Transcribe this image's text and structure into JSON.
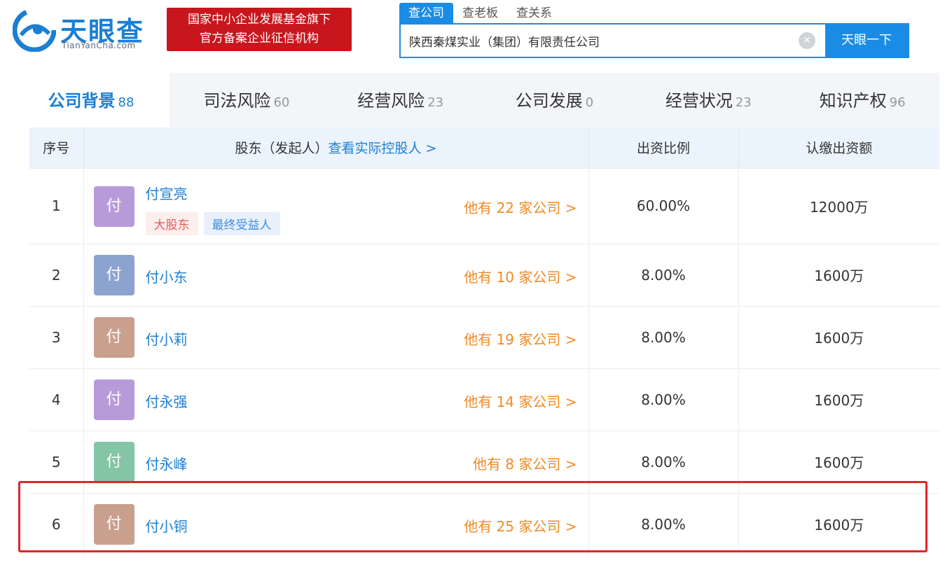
{
  "brand": {
    "name": "天眼查",
    "domain": "TianYanCha.com",
    "slogan_line1": "国家中小企业发展基金旗下",
    "slogan_line2": "官方备案企业征信机构"
  },
  "search": {
    "tabs": [
      "查公司",
      "查老板",
      "查关系"
    ],
    "active_tab": 0,
    "value": "陕西秦煤实业（集团）有限责任公司",
    "button_label": "天眼一下"
  },
  "category_tabs": [
    {
      "label": "公司背景",
      "count": "88"
    },
    {
      "label": "司法风险",
      "count": "60"
    },
    {
      "label": "经营风险",
      "count": "23"
    },
    {
      "label": "公司发展",
      "count": "0"
    },
    {
      "label": "经营状况",
      "count": "23"
    },
    {
      "label": "知识产权",
      "count": "96"
    }
  ],
  "table": {
    "headers": {
      "index": "序号",
      "holder": "股东（发起人）",
      "holder_link": "查看实际控股人 >",
      "ratio": "出资比例",
      "amount": "认缴出资额"
    },
    "rows": [
      {
        "index": "1",
        "avatar": "付",
        "avatar_color": "#b79bd9",
        "name": "付宣亮",
        "tags": [
          "大股东",
          "最终受益人"
        ],
        "companies": "他有 22 家公司 >",
        "ratio": "60.00%",
        "amount": "12000万"
      },
      {
        "index": "2",
        "avatar": "付",
        "avatar_color": "#8da3cf",
        "name": "付小东",
        "tags": [],
        "companies": "他有 10 家公司 >",
        "ratio": "8.00%",
        "amount": "1600万"
      },
      {
        "index": "3",
        "avatar": "付",
        "avatar_color": "#c9a08e",
        "name": "付小莉",
        "tags": [],
        "companies": "他有 19 家公司 >",
        "ratio": "8.00%",
        "amount": "1600万"
      },
      {
        "index": "4",
        "avatar": "付",
        "avatar_color": "#b79bd9",
        "name": "付永强",
        "tags": [],
        "companies": "他有 14 家公司 >",
        "ratio": "8.00%",
        "amount": "1600万"
      },
      {
        "index": "5",
        "avatar": "付",
        "avatar_color": "#83c5a5",
        "name": "付永峰",
        "tags": [],
        "companies": "他有 8 家公司 >",
        "ratio": "8.00%",
        "amount": "1600万"
      },
      {
        "index": "6",
        "avatar": "付",
        "avatar_color": "#c9a08e",
        "name": "付小铜",
        "tags": [],
        "companies": "他有 25 家公司 >",
        "ratio": "8.00%",
        "amount": "1600万"
      }
    ]
  },
  "colors": {
    "brand_blue": "#1b8ce6",
    "slogan_red": "#c8161d",
    "company_orange": "#f08a24",
    "highlight_red": "#e0262b"
  }
}
